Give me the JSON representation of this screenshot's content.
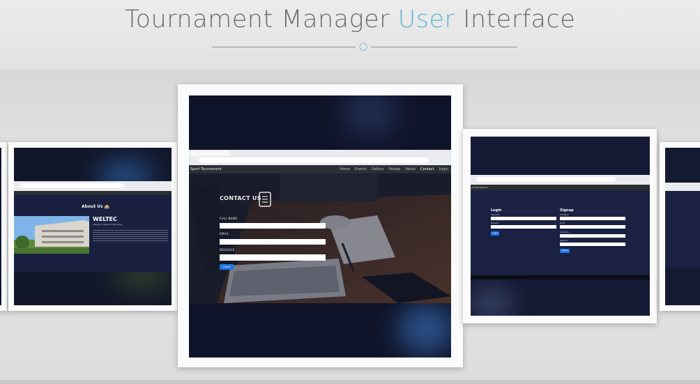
{
  "header": {
    "title_part1": "Tournament Manager ",
    "title_accent": "User",
    "title_part2": " Interface"
  },
  "center_card": {
    "brand": "Sport Tournament",
    "nav": [
      "Home",
      "Events",
      "Gallery",
      "People",
      "About",
      "Contact",
      "Login"
    ],
    "active_nav": "Contact",
    "heading": "CONTACT US",
    "fields": [
      {
        "label": "FULL NAME"
      },
      {
        "label": "EMAIL"
      },
      {
        "label": "MESSAGE"
      }
    ],
    "submit_label": "SUBMIT"
  },
  "left_card": {
    "heading": "About Us",
    "org_title": "WELTEC",
    "org_subtitle": "Wellington Institute of Technology"
  },
  "right_card": {
    "brand": "ort Tournament",
    "login": {
      "title": "Login",
      "fields": [
        "Username",
        "Password"
      ],
      "button": "Login"
    },
    "signup": {
      "title": "Signup",
      "fields": [
        "Full Name",
        "Email",
        "Username",
        "Password"
      ],
      "button": "Signup"
    }
  },
  "colors": {
    "accent": "#5fb8cf",
    "title_gray": "#676b6e",
    "button_blue": "#1f77e6"
  }
}
